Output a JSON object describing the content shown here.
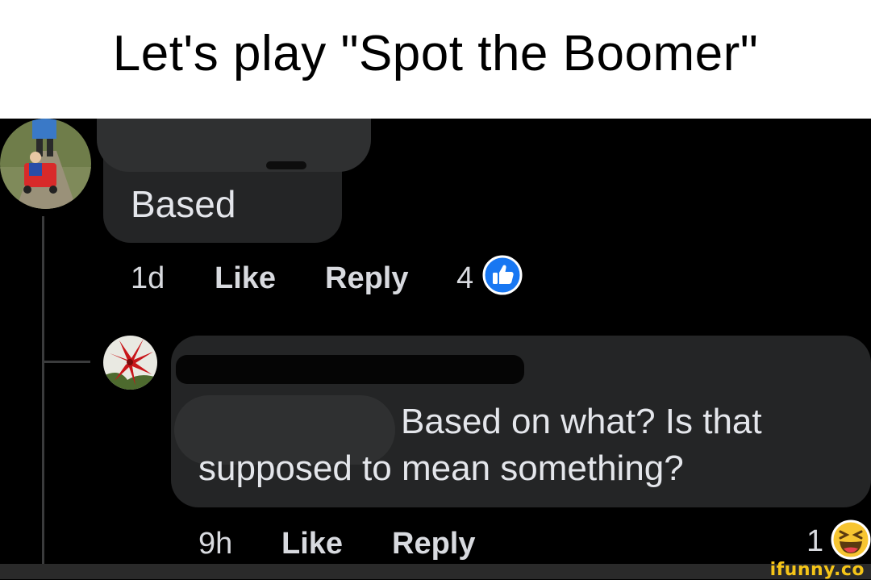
{
  "caption": {
    "text": "Let's play \"Spot the Boomer\""
  },
  "comment1": {
    "text": "Based",
    "time": "1d",
    "like_label": "Like",
    "reply_label": "Reply",
    "reaction_count": "4",
    "reaction_type": "like-icon"
  },
  "comment2": {
    "text_line1": "Based on what? Is that",
    "text_line2": "supposed to mean something?",
    "time": "9h",
    "like_label": "Like",
    "reply_label": "Reply",
    "reaction_count": "1",
    "reaction_type": "haha-emoji-icon"
  },
  "watermark": {
    "text": "ifunny.co"
  },
  "colors": {
    "background": "#000000",
    "bubble": "#242526",
    "text": "#e4e6eb",
    "like_blue": "#1877f2",
    "haha_yellow": "#f7c531",
    "watermark": "#f5c518"
  }
}
